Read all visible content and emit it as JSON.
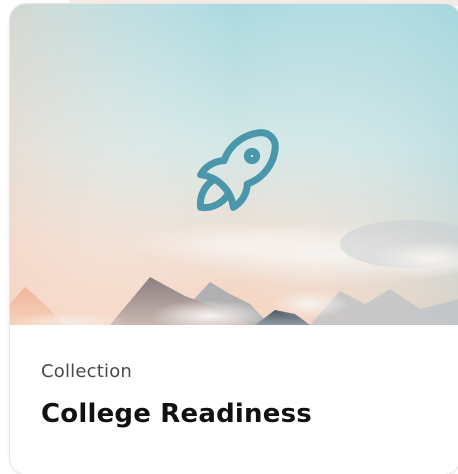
{
  "card": {
    "eyebrow": "Collection",
    "title": "College Readiness",
    "icon": "rocket-icon",
    "icon_color": "#4a97ab"
  },
  "colors": {
    "sky_top": "#aad9df",
    "sky_bottom": "#f6d9c8",
    "mountain": "#6f6a6e"
  }
}
